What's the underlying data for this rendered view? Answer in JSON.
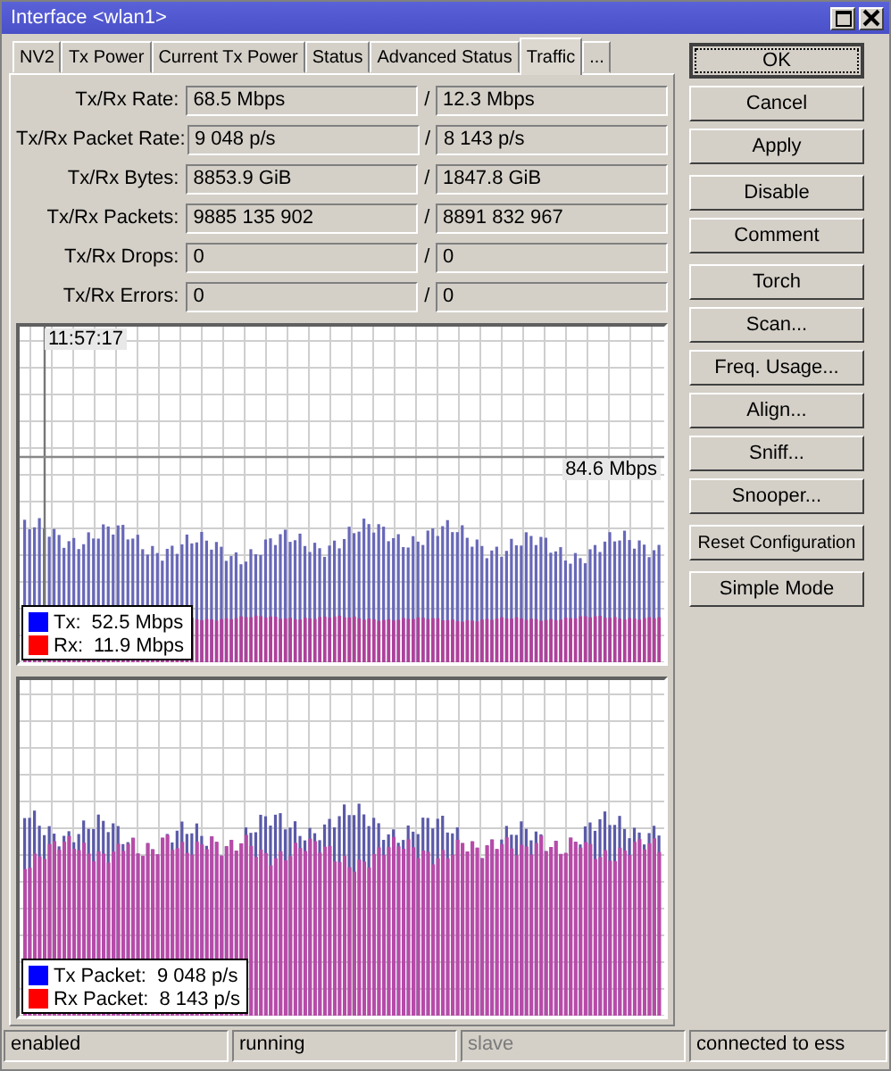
{
  "window": {
    "title": "Interface <wlan1>"
  },
  "tabs": [
    {
      "label": "NV2",
      "selected": false
    },
    {
      "label": "Tx Power",
      "selected": false
    },
    {
      "label": "Current Tx Power",
      "selected": false
    },
    {
      "label": "Status",
      "selected": false
    },
    {
      "label": "Advanced Status",
      "selected": false
    },
    {
      "label": "Traffic",
      "selected": true
    },
    {
      "label": "...",
      "selected": false
    }
  ],
  "stats": [
    {
      "label": "Tx/Rx Rate:",
      "tx": "68.5 Mbps",
      "separator": "/",
      "rx": "12.3 Mbps"
    },
    {
      "label": "Tx/Rx Packet Rate:",
      "tx": "9 048 p/s",
      "separator": "/",
      "rx": "8 143 p/s"
    },
    {
      "label": "Tx/Rx Bytes:",
      "tx": "8853.9 GiB",
      "separator": "/",
      "rx": "1847.8 GiB"
    },
    {
      "label": "Tx/Rx Packets:",
      "tx": "9885 135 902",
      "separator": "/",
      "rx": "8891 832 967"
    },
    {
      "label": "Tx/Rx Drops:",
      "tx": "0",
      "separator": "/",
      "rx": "0"
    },
    {
      "label": "Tx/Rx Errors:",
      "tx": "0",
      "separator": "/",
      "rx": "0"
    }
  ],
  "rate_graph": {
    "time": "11:57:17",
    "max_label": "84.6 Mbps",
    "legend": [
      {
        "name": "Tx:",
        "value": "52.5 Mbps",
        "color": "#0000ff"
      },
      {
        "name": "Rx:",
        "value": "11.9 Mbps",
        "color": "#ff0000"
      }
    ]
  },
  "packet_graph": {
    "legend": [
      {
        "name": "Tx Packet:",
        "value": "9 048 p/s",
        "color": "#0000ff"
      },
      {
        "name": "Rx Packet:",
        "value": "8 143 p/s",
        "color": "#ff0000"
      }
    ]
  },
  "button_groups": [
    [
      {
        "label": "OK",
        "default": true
      },
      {
        "label": "Cancel",
        "default": false
      },
      {
        "label": "Apply",
        "default": false
      }
    ],
    [
      {
        "label": "Disable",
        "default": false
      },
      {
        "label": "Comment",
        "default": false
      }
    ],
    [
      {
        "label": "Torch",
        "default": false
      },
      {
        "label": "Scan...",
        "default": false
      },
      {
        "label": "Freq. Usage...",
        "default": false
      },
      {
        "label": "Align...",
        "default": false
      },
      {
        "label": "Sniff...",
        "default": false
      },
      {
        "label": "Snooper...",
        "default": false
      }
    ],
    [
      {
        "label": "Reset Configuration",
        "default": false
      }
    ],
    [
      {
        "label": "Simple Mode",
        "default": false
      }
    ]
  ],
  "status_bar": [
    {
      "text": "enabled",
      "disabled": false
    },
    {
      "text": "running",
      "disabled": false
    },
    {
      "text": "slave",
      "disabled": true
    },
    {
      "text": "connected to ess",
      "disabled": false
    }
  ]
}
